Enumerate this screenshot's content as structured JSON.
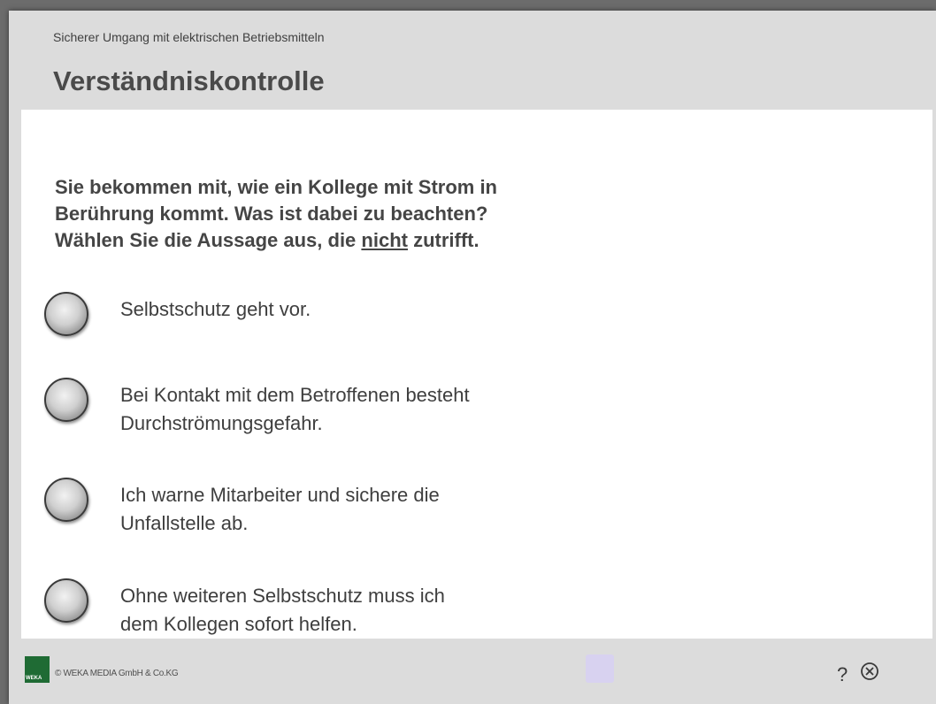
{
  "header": {
    "course_title": "Sicherer Umgang mit elektrischen Betriebsmitteln",
    "page_title": "Verständniskontrolle"
  },
  "question": {
    "line1": "Sie bekommen mit, wie ein Kollege mit Strom in",
    "line2": "Berührung kommt. Was ist dabei zu beachten?",
    "line3_before": "Wählen Sie die Aussage aus, die ",
    "line3_emphasis": "nicht",
    "line3_after": " zutrifft."
  },
  "options": [
    {
      "label": "Selbstschutz geht vor."
    },
    {
      "label": "Bei Kontakt mit dem Betroffenen besteht\nDurchströmungsgefahr."
    },
    {
      "label": "Ich warne Mitarbeiter und sichere die\nUnfallstelle ab."
    },
    {
      "label": "Ohne weiteren Selbstschutz muss ich\ndem Kollegen sofort helfen."
    }
  ],
  "footer": {
    "logo_text": "WEKA",
    "copyright": "© WEKA MEDIA GmbH & Co.KG",
    "help_label": "?",
    "close_icon": "close-circle-icon"
  },
  "colors": {
    "logo_green": "#1f6b34",
    "nav_square": "#d8d2f0"
  }
}
